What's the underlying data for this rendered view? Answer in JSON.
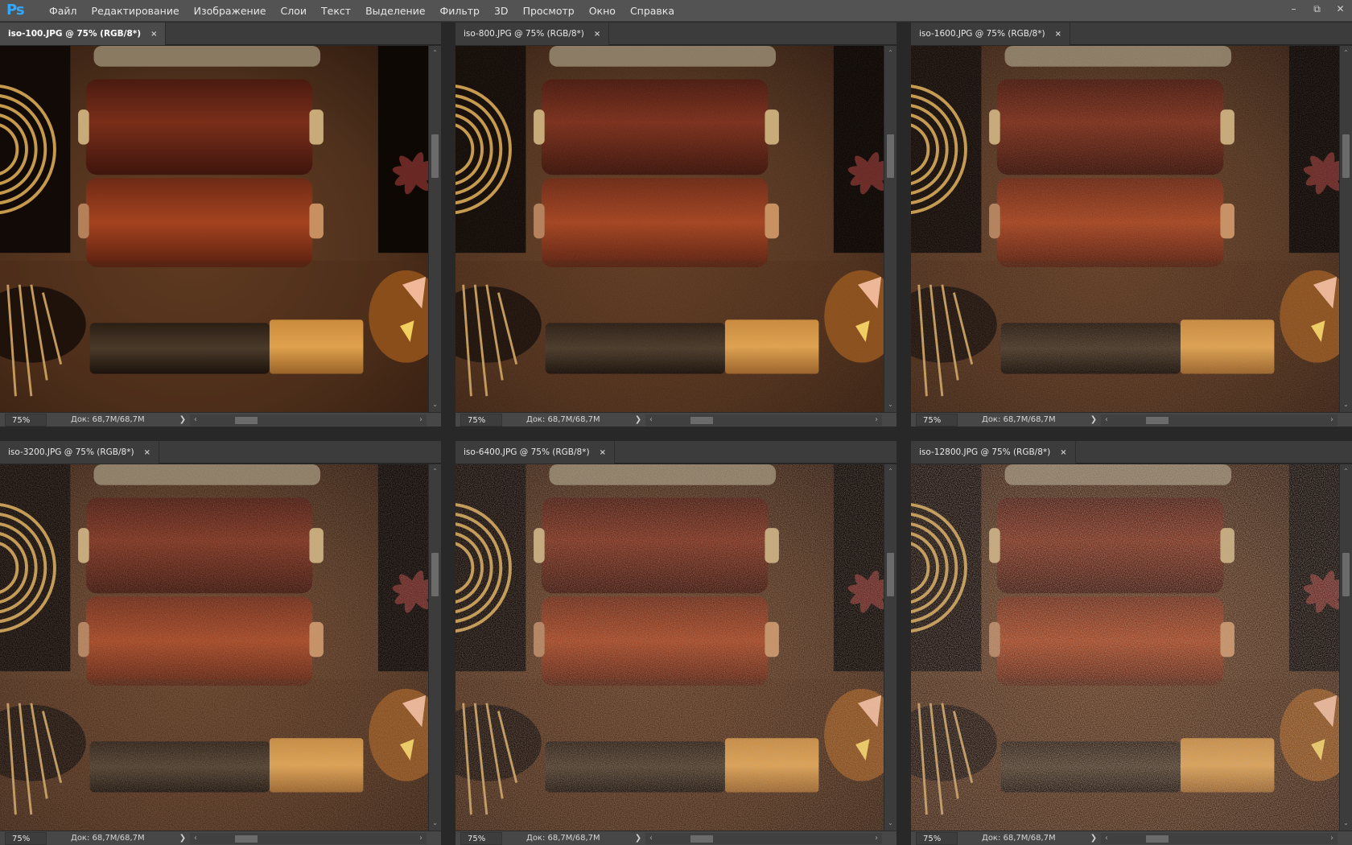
{
  "app": {
    "logo": "Ps",
    "accent_color": "#31a8ff"
  },
  "menu": [
    "Файл",
    "Редактирование",
    "Изображение",
    "Слои",
    "Текст",
    "Выделение",
    "Фильтр",
    "3D",
    "Просмотр",
    "Окно",
    "Справка"
  ],
  "window_controls": {
    "minimize": "–",
    "restore": "⧉",
    "close": "✕"
  },
  "documents": [
    {
      "title": "iso-100.JPG @ 75% (RGB/8*)",
      "active": true,
      "zoom": "75%",
      "doc_info": "Док: 68,7M/68,7M",
      "noise": 0.0
    },
    {
      "title": "iso-800.JPG @ 75% (RGB/8*)",
      "active": false,
      "zoom": "75%",
      "doc_info": "Док: 68,7M/68,7M",
      "noise": 0.15
    },
    {
      "title": "iso-1600.JPG @ 75% (RGB/8*)",
      "active": false,
      "zoom": "75%",
      "doc_info": "Док: 68,7M/68,7M",
      "noise": 0.3
    },
    {
      "title": "iso-3200.JPG @ 75% (RGB/8*)",
      "active": false,
      "zoom": "75%",
      "doc_info": "Док: 68,7M/68,7M",
      "noise": 0.45
    },
    {
      "title": "iso-6400.JPG @ 75% (RGB/8*)",
      "active": false,
      "zoom": "75%",
      "doc_info": "Док: 68,7M/68,7M",
      "noise": 0.6
    },
    {
      "title": "iso-12800.JPG @ 75% (RGB/8*)",
      "active": false,
      "zoom": "75%",
      "doc_info": "Док: 68,7M/68,7M",
      "noise": 0.8
    }
  ],
  "icons": {
    "tab_close": "×",
    "scroll_up": "⌃",
    "scroll_down": "⌄",
    "scroll_left": "‹",
    "scroll_right": "›",
    "status_menu": "❯"
  }
}
